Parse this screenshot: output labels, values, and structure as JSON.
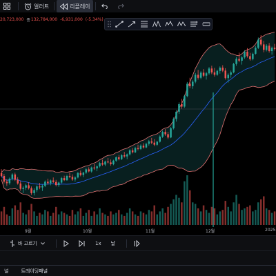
{
  "toolbar": {
    "alert_label": "얼러트",
    "replay_label": "리플레이"
  },
  "infobar": {
    "close_value": "20,723,000",
    "close_label": "종",
    "close_prefix": "132,784,000",
    "change": "-6,931,000",
    "change_pct": "(-5.34%)"
  },
  "xaxis": {
    "labels": [
      "9월",
      "10월",
      "11월",
      "12월",
      "2025"
    ]
  },
  "replay_bar": {
    "select_label": "바 고르기",
    "speed_label": "1x",
    "step_label": "날"
  },
  "bottom": {
    "tab_left": "널",
    "tab_trading": "트레이딩패널"
  },
  "colors": {
    "up": "#26a69a",
    "down": "#ef5350",
    "band_upper": "#e57373",
    "band_lower": "#e57373",
    "mid_line": "#2962ff",
    "band_fill": "#0b2a2a"
  },
  "chart_data": {
    "type": "candlestick",
    "series_description": "",
    "candles": [
      [
        78.5,
        79.8,
        77.0,
        77.5
      ],
      [
        77.5,
        78.2,
        75.0,
        75.6
      ],
      [
        75.6,
        76.4,
        74.2,
        75.1
      ],
      [
        75.1,
        77.0,
        74.6,
        76.6
      ],
      [
        76.6,
        78.4,
        76.0,
        78.0
      ],
      [
        78.0,
        78.6,
        75.8,
        76.2
      ],
      [
        76.2,
        77.1,
        74.6,
        75.0
      ],
      [
        75.0,
        75.8,
        72.6,
        73.2
      ],
      [
        73.2,
        74.1,
        71.8,
        73.6
      ],
      [
        73.6,
        74.9,
        72.8,
        74.4
      ],
      [
        74.4,
        75.4,
        73.0,
        73.4
      ],
      [
        73.4,
        74.0,
        71.2,
        71.8
      ],
      [
        71.8,
        73.4,
        71.0,
        72.8
      ],
      [
        72.8,
        74.4,
        72.1,
        74.0
      ],
      [
        74.0,
        75.2,
        73.1,
        73.7
      ],
      [
        73.7,
        74.6,
        72.5,
        74.2
      ],
      [
        74.2,
        76.0,
        73.8,
        75.6
      ],
      [
        75.6,
        76.6,
        74.6,
        75.1
      ],
      [
        75.1,
        76.3,
        74.4,
        76.0
      ],
      [
        76.0,
        77.0,
        75.2,
        75.5
      ],
      [
        75.5,
        76.2,
        74.0,
        74.5
      ],
      [
        74.5,
        75.6,
        73.9,
        75.3
      ],
      [
        75.3,
        77.2,
        75.0,
        76.8
      ],
      [
        76.8,
        77.6,
        75.8,
        76.1
      ],
      [
        76.1,
        77.9,
        75.9,
        77.5
      ],
      [
        77.5,
        78.6,
        76.8,
        77.2
      ],
      [
        77.2,
        78.0,
        75.9,
        76.3
      ],
      [
        76.3,
        77.4,
        75.6,
        77.0
      ],
      [
        77.0,
        78.8,
        76.7,
        78.5
      ],
      [
        78.5,
        79.3,
        77.4,
        77.8
      ],
      [
        77.8,
        78.9,
        77.1,
        78.6
      ],
      [
        78.6,
        80.1,
        78.2,
        79.7
      ],
      [
        79.7,
        80.4,
        78.7,
        79.0
      ],
      [
        79.0,
        80.6,
        78.6,
        80.3
      ],
      [
        80.3,
        81.4,
        79.5,
        80.0
      ],
      [
        80.0,
        81.0,
        79.1,
        80.7
      ],
      [
        80.7,
        82.2,
        80.3,
        81.8
      ],
      [
        81.8,
        82.9,
        80.9,
        81.3
      ],
      [
        81.3,
        82.6,
        80.8,
        82.3
      ],
      [
        82.3,
        83.5,
        81.7,
        82.0
      ],
      [
        82.0,
        83.0,
        80.9,
        81.4
      ],
      [
        81.4,
        82.9,
        81.1,
        82.6
      ],
      [
        82.6,
        84.0,
        82.2,
        83.7
      ],
      [
        83.7,
        84.5,
        82.7,
        83.1
      ],
      [
        83.1,
        84.8,
        82.8,
        84.4
      ],
      [
        84.4,
        85.5,
        83.6,
        84.0
      ],
      [
        84.0,
        85.0,
        83.1,
        84.7
      ],
      [
        84.7,
        86.4,
        84.3,
        86.0
      ],
      [
        86.0,
        86.8,
        85.0,
        85.4
      ],
      [
        85.4,
        87.2,
        85.1,
        86.8
      ],
      [
        86.8,
        87.9,
        86.0,
        86.5
      ],
      [
        86.5,
        88.0,
        86.2,
        87.6
      ],
      [
        87.6,
        88.4,
        86.6,
        87.0
      ],
      [
        87.0,
        88.6,
        86.7,
        88.2
      ],
      [
        88.2,
        89.5,
        87.6,
        89.0
      ],
      [
        89.0,
        90.2,
        88.1,
        88.6
      ],
      [
        88.6,
        89.8,
        87.4,
        87.9
      ],
      [
        87.9,
        89.2,
        87.5,
        88.9
      ],
      [
        88.9,
        91.0,
        88.6,
        90.6
      ],
      [
        90.6,
        92.6,
        90.2,
        92.2
      ],
      [
        92.2,
        93.1,
        90.9,
        91.4
      ],
      [
        91.4,
        92.2,
        89.8,
        90.3
      ],
      [
        90.3,
        93.8,
        90.1,
        93.4
      ],
      [
        93.4,
        97.0,
        93.0,
        96.5
      ],
      [
        96.5,
        99.4,
        95.6,
        98.9
      ],
      [
        98.9,
        102.0,
        98.2,
        101.4
      ],
      [
        101.4,
        103.2,
        99.9,
        100.6
      ],
      [
        100.6,
        104.6,
        100.2,
        104.1
      ],
      [
        104.1,
        108.8,
        103.7,
        108.2
      ],
      [
        108.2,
        110.2,
        106.7,
        107.4
      ],
      [
        107.4,
        109.4,
        106.5,
        108.9
      ],
      [
        108.9,
        111.8,
        108.4,
        111.2
      ],
      [
        111.2,
        112.8,
        109.6,
        110.2
      ],
      [
        110.2,
        112.4,
        109.7,
        111.9
      ],
      [
        111.9,
        113.1,
        110.4,
        110.9
      ],
      [
        110.9,
        112.2,
        109.6,
        111.7
      ],
      [
        111.7,
        113.8,
        111.2,
        113.3
      ],
      [
        113.3,
        114.2,
        111.4,
        112.0
      ],
      [
        112.0,
        113.5,
        110.6,
        111.2
      ],
      [
        111.2,
        112.9,
        110.9,
        112.5
      ],
      [
        112.5,
        114.0,
        111.6,
        113.6
      ],
      [
        113.6,
        114.4,
        112.1,
        112.6
      ],
      [
        112.6,
        113.4,
        109.6,
        110.1
      ],
      [
        110.1,
        111.7,
        108.6,
        111.2
      ],
      [
        111.2,
        112.6,
        110.2,
        112.0
      ],
      [
        112.0,
        115.2,
        111.7,
        114.8
      ],
      [
        114.8,
        117.1,
        114.2,
        116.5
      ],
      [
        116.5,
        118.6,
        115.4,
        115.9
      ],
      [
        115.9,
        117.4,
        114.6,
        117.0
      ],
      [
        117.0,
        119.4,
        116.5,
        118.9
      ],
      [
        118.9,
        120.1,
        116.9,
        117.4
      ],
      [
        117.4,
        118.5,
        115.9,
        116.4
      ],
      [
        116.4,
        118.6,
        116.0,
        118.2
      ],
      [
        118.2,
        120.8,
        117.9,
        120.2
      ],
      [
        120.2,
        123.6,
        119.8,
        122.9
      ],
      [
        122.9,
        124.4,
        120.7,
        121.3
      ],
      [
        121.3,
        122.5,
        118.7,
        119.5
      ],
      [
        119.5,
        121.4,
        119.0,
        120.9
      ],
      [
        120.9,
        121.8,
        118.6,
        119.1
      ],
      [
        119.1,
        120.6,
        117.9,
        120.2
      ],
      [
        120.2,
        121.5,
        119.3,
        119.8
      ]
    ],
    "volume": [
      18,
      24,
      14,
      12,
      22,
      26,
      20,
      30,
      16,
      14,
      20,
      28,
      18,
      12,
      16,
      14,
      20,
      18,
      12,
      16,
      24,
      14,
      18,
      16,
      14,
      12,
      20,
      14,
      18,
      22,
      12,
      16,
      20,
      12,
      18,
      14,
      22,
      16,
      14,
      12,
      18,
      14,
      16,
      20,
      14,
      12,
      16,
      22,
      18,
      14,
      12,
      18,
      16,
      14,
      20,
      18,
      26,
      14,
      18,
      22,
      16,
      24,
      28,
      34,
      40,
      36,
      30,
      58,
      66,
      46,
      30,
      28,
      22,
      18,
      26,
      20,
      16,
      24,
      22,
      14,
      18,
      20,
      32,
      24,
      18,
      30,
      40,
      28,
      20,
      22,
      24,
      26,
      18,
      20,
      30,
      34,
      38,
      22,
      20,
      16,
      18
    ]
  }
}
